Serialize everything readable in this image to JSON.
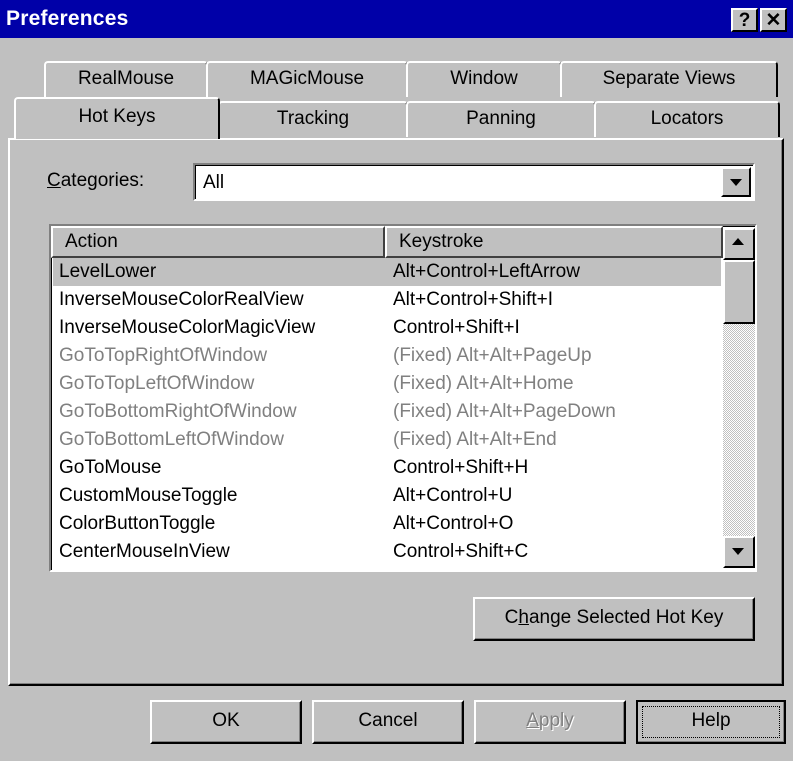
{
  "window": {
    "title": "Preferences",
    "help_glyph": "?",
    "close_glyph": "✕"
  },
  "tabs_back": [
    {
      "label": "RealMouse"
    },
    {
      "label": "MAGicMouse"
    },
    {
      "label": "Window"
    },
    {
      "label": "Separate Views"
    }
  ],
  "tabs_front": [
    {
      "label": "Hot Keys",
      "active": true
    },
    {
      "label": "Tracking"
    },
    {
      "label": "Panning"
    },
    {
      "label": "Locators"
    }
  ],
  "categories": {
    "label_mnemonic": "C",
    "label_rest": "ategories:",
    "value": "All"
  },
  "list": {
    "columns": [
      "Action",
      "Keystroke"
    ],
    "rows": [
      {
        "action": "LevelLower",
        "keystroke": "Alt+Control+LeftArrow",
        "selected": true
      },
      {
        "action": "InverseMouseColorRealView",
        "keystroke": "Alt+Control+Shift+I"
      },
      {
        "action": "InverseMouseColorMagicView",
        "keystroke": "Control+Shift+I"
      },
      {
        "action": "GoToTopRightOfWindow",
        "keystroke": "(Fixed) Alt+Alt+PageUp",
        "disabled": true
      },
      {
        "action": "GoToTopLeftOfWindow",
        "keystroke": "(Fixed) Alt+Alt+Home",
        "disabled": true
      },
      {
        "action": "GoToBottomRightOfWindow",
        "keystroke": "(Fixed) Alt+Alt+PageDown",
        "disabled": true
      },
      {
        "action": "GoToBottomLeftOfWindow",
        "keystroke": "(Fixed) Alt+Alt+End",
        "disabled": true
      },
      {
        "action": "GoToMouse",
        "keystroke": "Control+Shift+H"
      },
      {
        "action": "CustomMouseToggle",
        "keystroke": "Alt+Control+U"
      },
      {
        "action": "ColorButtonToggle",
        "keystroke": "Alt+Control+O"
      },
      {
        "action": "CenterMouseInView",
        "keystroke": "Control+Shift+C"
      }
    ]
  },
  "change_button": {
    "pre": "C",
    "mnemonic": "h",
    "post": "ange Selected Hot Key"
  },
  "buttons": {
    "ok": "OK",
    "cancel": "Cancel",
    "apply_mnemonic": "A",
    "apply_rest": "pply",
    "help": "Help"
  },
  "colors": {
    "titlebar": "#0000a8",
    "face": "#c0c0c0",
    "disabled_text": "#808080"
  }
}
